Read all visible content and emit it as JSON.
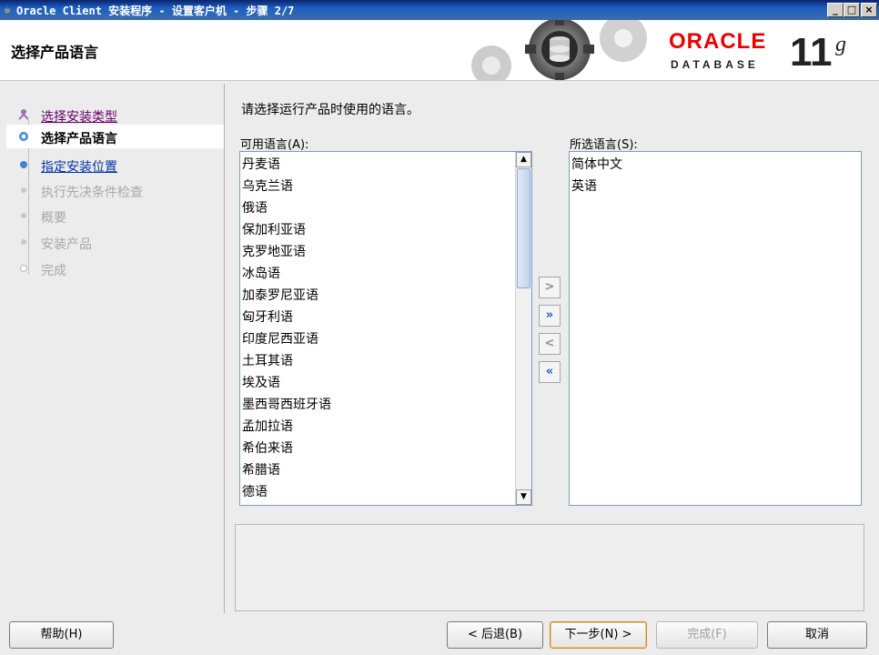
{
  "window": {
    "title": "Oracle Client 安装程序 - 设置客户机 - 步骤 2/7",
    "minimize_label": "_",
    "maximize_label": "□",
    "close_label": "×"
  },
  "header": {
    "page_title": "选择产品语言",
    "logo_oracle": "ORACLE",
    "logo_database": "DATABASE",
    "logo_version": "11",
    "logo_version_suffix": "g"
  },
  "steps": [
    {
      "label": "选择安装类型",
      "state": "visited"
    },
    {
      "label": "选择产品语言",
      "state": "current"
    },
    {
      "label": "指定安装位置",
      "state": "link"
    },
    {
      "label": "执行先决条件检查",
      "state": "disabled"
    },
    {
      "label": "概要",
      "state": "disabled"
    },
    {
      "label": "安装产品",
      "state": "disabled"
    },
    {
      "label": "完成",
      "state": "disabled"
    }
  ],
  "main": {
    "prompt": "请选择运行产品时使用的语言。",
    "available_label": "可用语言(A):",
    "selected_label": "所选语言(S):",
    "available_languages": [
      "丹麦语",
      "乌克兰语",
      "俄语",
      "保加利亚语",
      "克罗地亚语",
      "冰岛语",
      "加泰罗尼亚语",
      "匈牙利语",
      "印度尼西亚语",
      "土耳其语",
      "埃及语",
      "墨西哥西班牙语",
      "孟加拉语",
      "希伯来语",
      "希腊语",
      "德语"
    ],
    "selected_languages": [
      "简体中文",
      "英语"
    ],
    "move_one_right": ">",
    "move_all_right": "»",
    "move_one_left": "<",
    "move_all_left": "«"
  },
  "buttons": {
    "help": "帮助(H)",
    "back": "< 后退(B)",
    "next": "下一步(N) >",
    "finish": "完成(F)",
    "cancel": "取消"
  },
  "colors": {
    "title_bar": "#0a246a",
    "oracle_red": "#e00000",
    "link_blue": "#0033aa",
    "visited_purple": "#660066",
    "move_icon_blue": "#1b5fc4"
  }
}
